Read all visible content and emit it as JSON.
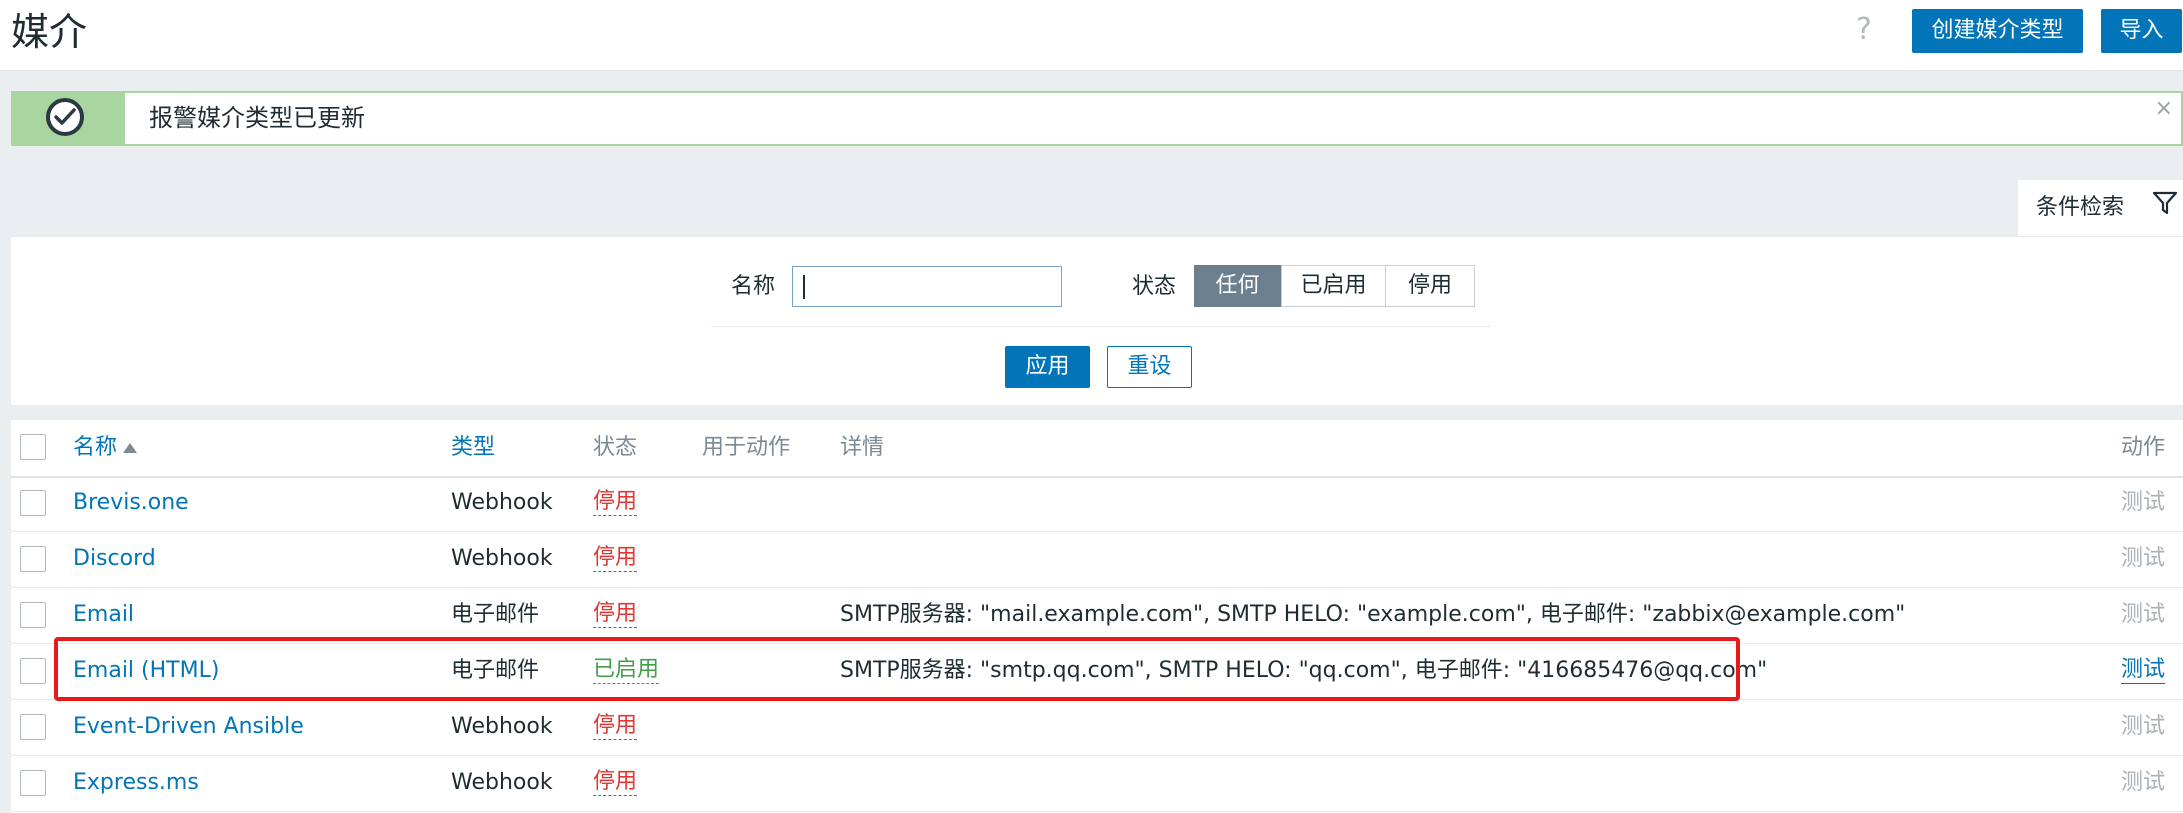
{
  "header": {
    "title": "媒介",
    "help_icon": "?",
    "create_button": "创建媒介类型",
    "import_button": "导入"
  },
  "message": {
    "text": "报警媒介类型已更新",
    "close": "×",
    "icon": "check-icon",
    "color": "#a8d5a0"
  },
  "filter": {
    "tab_label": "条件检索",
    "name_label": "名称",
    "name_value": "",
    "status_label": "状态",
    "status_options": [
      "任何",
      "已启用",
      "停用"
    ],
    "status_selected": "任何",
    "apply_button": "应用",
    "reset_button": "重设"
  },
  "table": {
    "columns": {
      "name": "名称",
      "type": "类型",
      "status": "状态",
      "used_in_actions": "用于动作",
      "details": "详情",
      "action": "动作"
    },
    "rows": [
      {
        "name": "Brevis.one",
        "type": "Webhook",
        "status": "停用",
        "details": "",
        "action": "测试"
      },
      {
        "name": "Discord",
        "type": "Webhook",
        "status": "停用",
        "details": "",
        "action": "测试"
      },
      {
        "name": "Email",
        "type": "电子邮件",
        "status": "停用",
        "details": "SMTP服务器: \"mail.example.com\", SMTP HELO: \"example.com\", 电子邮件: \"zabbix@example.com\"",
        "action": "测试"
      },
      {
        "name": "Email (HTML)",
        "type": "电子邮件",
        "status": "已启用",
        "details": "SMTP服务器: \"smtp.qq.com\", SMTP HELO: \"qq.com\", 电子邮件: \"416685476@qq.com\"",
        "action": "测试"
      },
      {
        "name": "Event-Driven Ansible",
        "type": "Webhook",
        "status": "停用",
        "details": "",
        "action": "测试"
      },
      {
        "name": "Express.ms",
        "type": "Webhook",
        "status": "停用",
        "details": "",
        "action": "测试"
      }
    ]
  },
  "colors": {
    "accent": "#0275b8",
    "disabled": "#e33734",
    "enabled": "#429e47",
    "highlight": "#e8191a"
  }
}
